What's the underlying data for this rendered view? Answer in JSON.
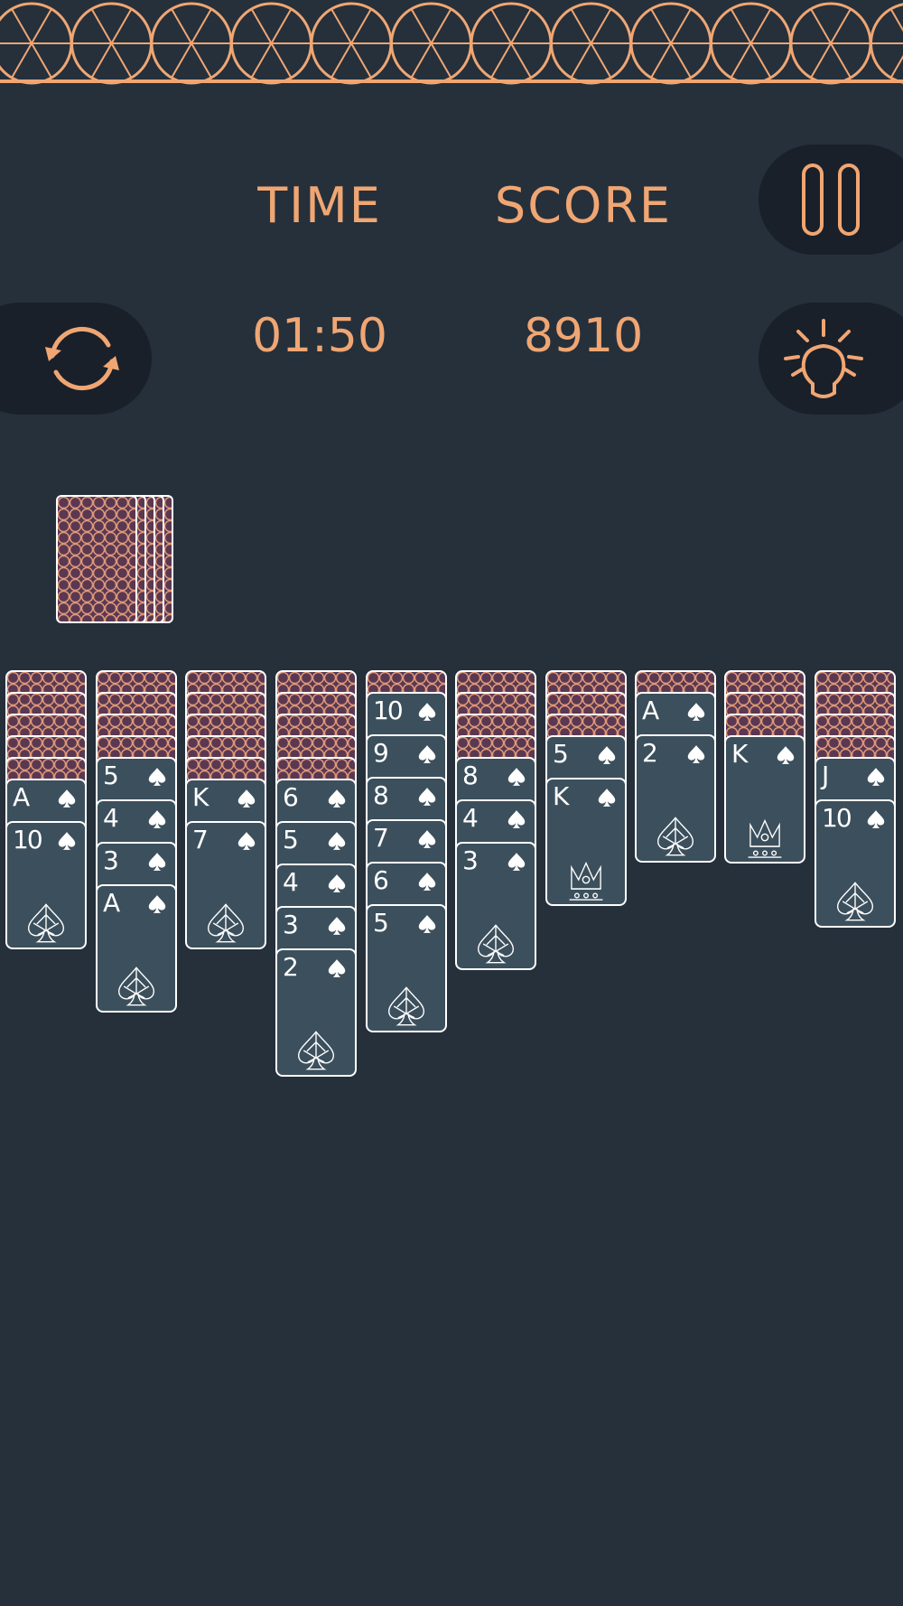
{
  "hud": {
    "time_label": "TIME",
    "time_value": "01:50",
    "score_label": "SCORE",
    "score_value": "8910"
  },
  "buttons": {
    "pause_icon": "pause-icon",
    "restart_icon": "refresh-icon",
    "hint_icon": "lightbulb-icon"
  },
  "colors": {
    "background": "#25303b",
    "accent": "#f0a673",
    "button_bg": "#19202a",
    "card_face": "#3c4f5c",
    "card_back": "#5a3852"
  },
  "stock": {
    "cards_remaining_stacks": 5
  },
  "tableau": [
    {
      "face_down": 5,
      "face_up": [
        "A",
        "10"
      ]
    },
    {
      "face_down": 4,
      "face_up": [
        "5",
        "4",
        "3",
        "A"
      ]
    },
    {
      "face_down": 5,
      "face_up": [
        "K",
        "7"
      ]
    },
    {
      "face_down": 5,
      "face_up": [
        "6",
        "5",
        "4",
        "3",
        "2"
      ]
    },
    {
      "face_down": 1,
      "face_up": [
        "10",
        "9",
        "8",
        "7",
        "6",
        "5"
      ]
    },
    {
      "face_down": 4,
      "face_up": [
        "8",
        "4",
        "3"
      ]
    },
    {
      "face_down": 3,
      "face_up": [
        "5",
        "K"
      ]
    },
    {
      "face_down": 1,
      "face_up": [
        "A",
        "2"
      ]
    },
    {
      "face_down": 3,
      "face_up": [
        "K"
      ]
    },
    {
      "face_down": 4,
      "face_up": [
        "J",
        "10"
      ]
    }
  ]
}
